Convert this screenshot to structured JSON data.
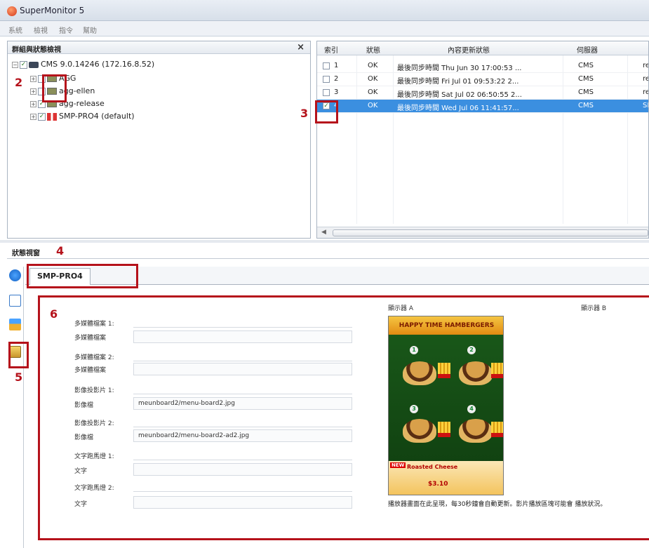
{
  "window": {
    "title": "SuperMonitor 5"
  },
  "menu": [
    "系統",
    "檢視",
    "指令",
    "幫助"
  ],
  "tree_pane": {
    "title": "群組與狀態檢視",
    "close": "×",
    "items": [
      {
        "label": "CMS 9.0.14246 (172.16.8.52)",
        "checked": true
      },
      {
        "label": "AGG",
        "checked": false
      },
      {
        "label": "agg-ellen",
        "checked": false
      },
      {
        "label": "agg-release",
        "checked": true
      },
      {
        "label": "SMP-PRO4 (default)",
        "checked": true
      }
    ]
  },
  "table": {
    "columns": [
      "索引",
      "狀態",
      "內容更新狀態",
      "伺服器",
      ""
    ],
    "rows": [
      {
        "index": "1",
        "status": "OK",
        "update": "最後同步時間 Thu Jun 30 17:00:53 ...",
        "server": "CMS",
        "extra": "rel",
        "checked": false,
        "selected": false
      },
      {
        "index": "2",
        "status": "OK",
        "update": "最後同步時間 Fri Jul 01 09:53:22 2...",
        "server": "CMS",
        "extra": "rel",
        "checked": false,
        "selected": false
      },
      {
        "index": "3",
        "status": "OK",
        "update": "最後同步時間 Sat Jul 02 06:50:55 2...",
        "server": "CMS",
        "extra": "rel",
        "checked": false,
        "selected": false
      },
      {
        "index": "4",
        "status": "OK",
        "update": "最後同步時間 Wed Jul 06 11:41:57...",
        "server": "CMS",
        "extra": "SMP",
        "checked": true,
        "selected": true
      }
    ]
  },
  "status_window": {
    "title": "狀態視窗",
    "tab": "SMP-PRO4",
    "fields": [
      {
        "label": "多媒體檔案 1:",
        "kind": "line"
      },
      {
        "label": "多媒體檔案",
        "kind": "box",
        "value": ""
      },
      {
        "label": "多媒體檔案 2:",
        "kind": "line"
      },
      {
        "label": "多媒體檔案",
        "kind": "box",
        "value": ""
      },
      {
        "label": "影像投影片 1:",
        "kind": "line"
      },
      {
        "label": "影像檔",
        "kind": "box",
        "value": "meunboard2/menu-board2.jpg"
      },
      {
        "label": "影像投影片 2:",
        "kind": "line"
      },
      {
        "label": "影像檔",
        "kind": "box",
        "value": "meunboard2/menu-board2-ad2.jpg"
      },
      {
        "label": "文字跑馬燈 1:",
        "kind": "line"
      },
      {
        "label": "文字",
        "kind": "box",
        "value": ""
      },
      {
        "label": "文字跑馬燈 2:",
        "kind": "line"
      },
      {
        "label": "文字",
        "kind": "box",
        "value": ""
      }
    ],
    "display_a": "顯示器 A",
    "display_b": "顯示器 B",
    "poster": {
      "top_text": "HAPPY TIME HAMBERGERS",
      "bottom_title": "Roasted Cheese",
      "price": "$3.10",
      "numbers": [
        "1",
        "2",
        "3",
        "4"
      ],
      "new_badge": "NEW"
    },
    "description": "播放器畫面在此呈現，每30秒鐘會自動更新。影片播放區塊可能會 播放狀況。"
  },
  "callouts": [
    "2",
    "3",
    "4",
    "5",
    "6"
  ],
  "colors": {
    "callout_red": "#b5121b",
    "selection_blue": "#3b8fe0"
  }
}
